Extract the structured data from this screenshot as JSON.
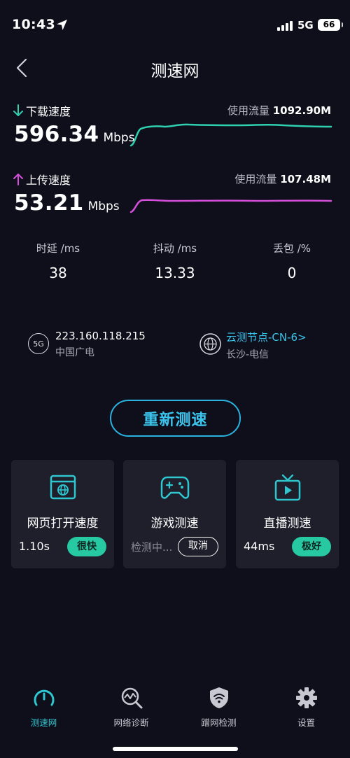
{
  "status_bar": {
    "time": "10:43",
    "network": "5G",
    "battery": "66"
  },
  "nav": {
    "title": "测速网"
  },
  "download": {
    "label": "下载速度",
    "usage_label": "使用流量",
    "usage_value": "1092.90M",
    "speed": "596.34",
    "unit": "Mbps",
    "color": "#2fd0b0"
  },
  "upload": {
    "label": "上传速度",
    "usage_label": "使用流量",
    "usage_value": "107.48M",
    "speed": "53.21",
    "unit": "Mbps",
    "color": "#d64fdb"
  },
  "stats": [
    {
      "label": "时延 /ms",
      "value": "38"
    },
    {
      "label": "抖动 /ms",
      "value": "13.33"
    },
    {
      "label": "丢包 /%",
      "value": "0"
    }
  ],
  "network_info": {
    "icon_text": "5G",
    "ip": "223.160.118.215",
    "carrier": "中国广电",
    "node": "云测节点-CN-6>",
    "node_location": "长沙-电信"
  },
  "retest_label": "重新测速",
  "cards": [
    {
      "title": "网页打开速度",
      "value": "1.10s",
      "badge": "很快"
    },
    {
      "title": "游戏测速",
      "value": "检测中...",
      "badge": "取消"
    },
    {
      "title": "直播测速",
      "value": "44ms",
      "badge": "极好"
    }
  ],
  "tabs": [
    {
      "label": "测速网",
      "icon": "speedometer-icon",
      "active": true
    },
    {
      "label": "网络诊断",
      "icon": "diagnosis-icon",
      "active": false
    },
    {
      "label": "蹭网检测",
      "icon": "wifi-shield-icon",
      "active": false
    },
    {
      "label": "设置",
      "icon": "gear-icon",
      "active": false
    }
  ],
  "accent_color": "#2ab3df"
}
